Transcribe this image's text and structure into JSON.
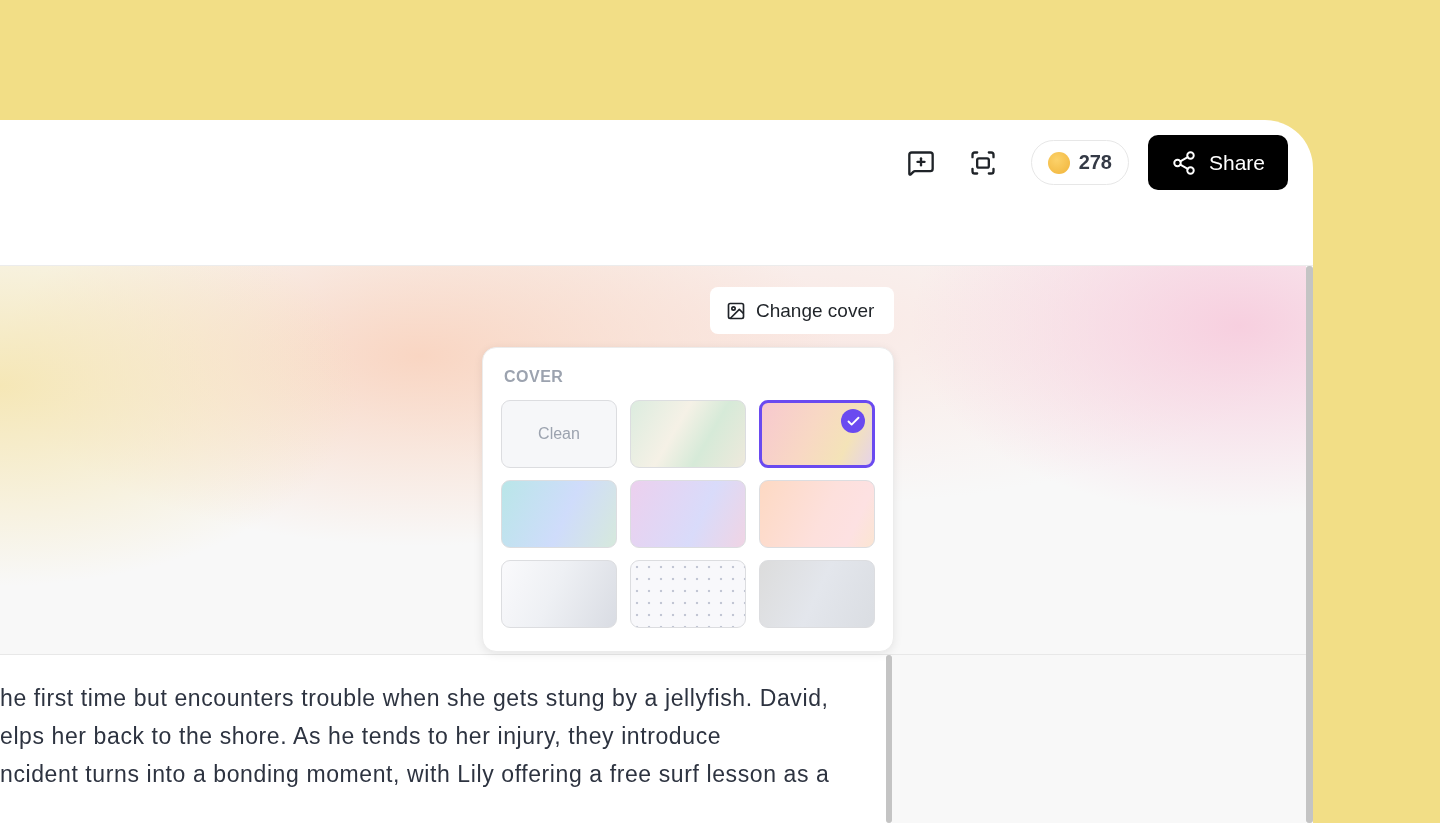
{
  "header": {
    "coins": "278",
    "share_label": "Share"
  },
  "cover": {
    "change_cover_label": "Change cover",
    "popover": {
      "title": "COVER",
      "tiles": [
        {
          "kind": "clean",
          "label": "Clean",
          "selected": false
        },
        {
          "kind": "gradient",
          "selected": false
        },
        {
          "kind": "gradient",
          "selected": true
        },
        {
          "kind": "gradient",
          "selected": false
        },
        {
          "kind": "gradient",
          "selected": false
        },
        {
          "kind": "gradient",
          "selected": false
        },
        {
          "kind": "gradient",
          "selected": false
        },
        {
          "kind": "dots",
          "selected": false
        },
        {
          "kind": "gradient",
          "selected": false
        }
      ]
    }
  },
  "document": {
    "lines": [
      "he first time but encounters trouble when she gets stung by a jellyfish. David,",
      "elps her back to the shore. As he tends to her injury, they introduce",
      "ncident turns into a bonding moment, with Lily offering a free surf lesson as a"
    ]
  }
}
